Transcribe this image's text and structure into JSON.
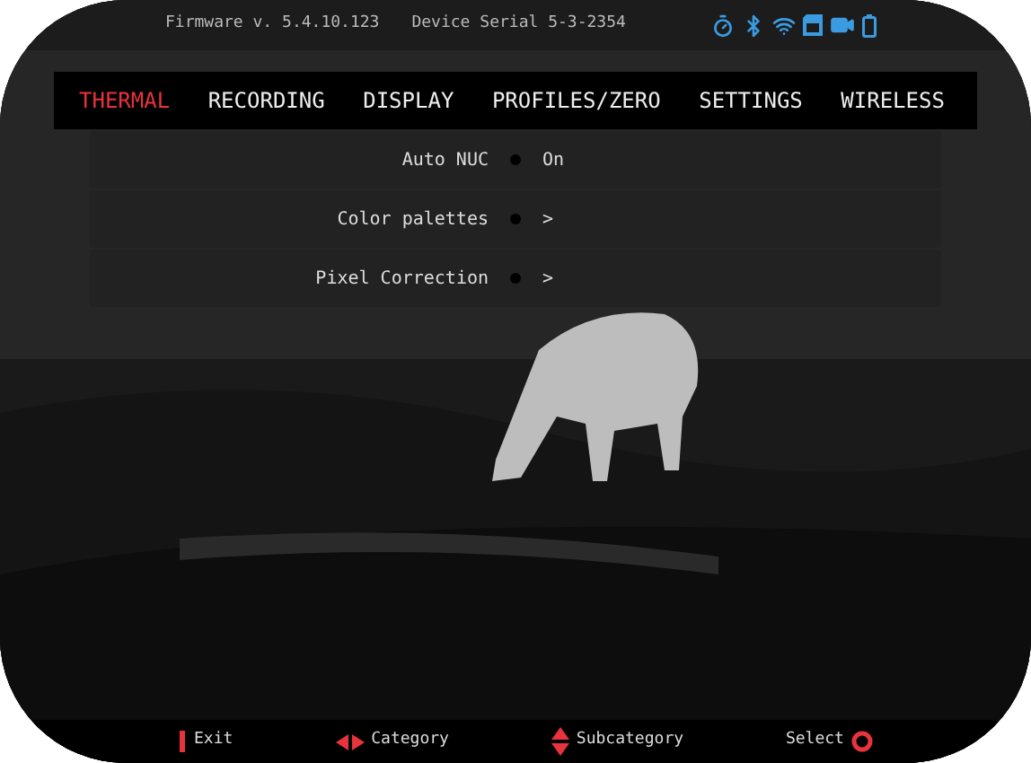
{
  "status_bar": {
    "firmware": "Firmware v. 5.4.10.123",
    "serial": "Device Serial 5-3-2354"
  },
  "tabs": [
    {
      "label": "THERMAL",
      "selected": true
    },
    {
      "label": "RECORDING",
      "selected": false
    },
    {
      "label": "DISPLAY",
      "selected": false
    },
    {
      "label": "PROFILES/ZERO",
      "selected": false
    },
    {
      "label": "SETTINGS",
      "selected": false
    },
    {
      "label": "WIRELESS",
      "selected": false
    }
  ],
  "menu": [
    {
      "label": "Auto NUC",
      "value": "On"
    },
    {
      "label": "Color palettes",
      "value": ">"
    },
    {
      "label": "Pixel Correction",
      "value": ">"
    }
  ],
  "footer": [
    {
      "kind": "exit",
      "label": "Exit"
    },
    {
      "kind": "category",
      "label": "Category"
    },
    {
      "kind": "subcategory",
      "label": "Subcategory"
    },
    {
      "kind": "select",
      "label": "Select"
    }
  ]
}
